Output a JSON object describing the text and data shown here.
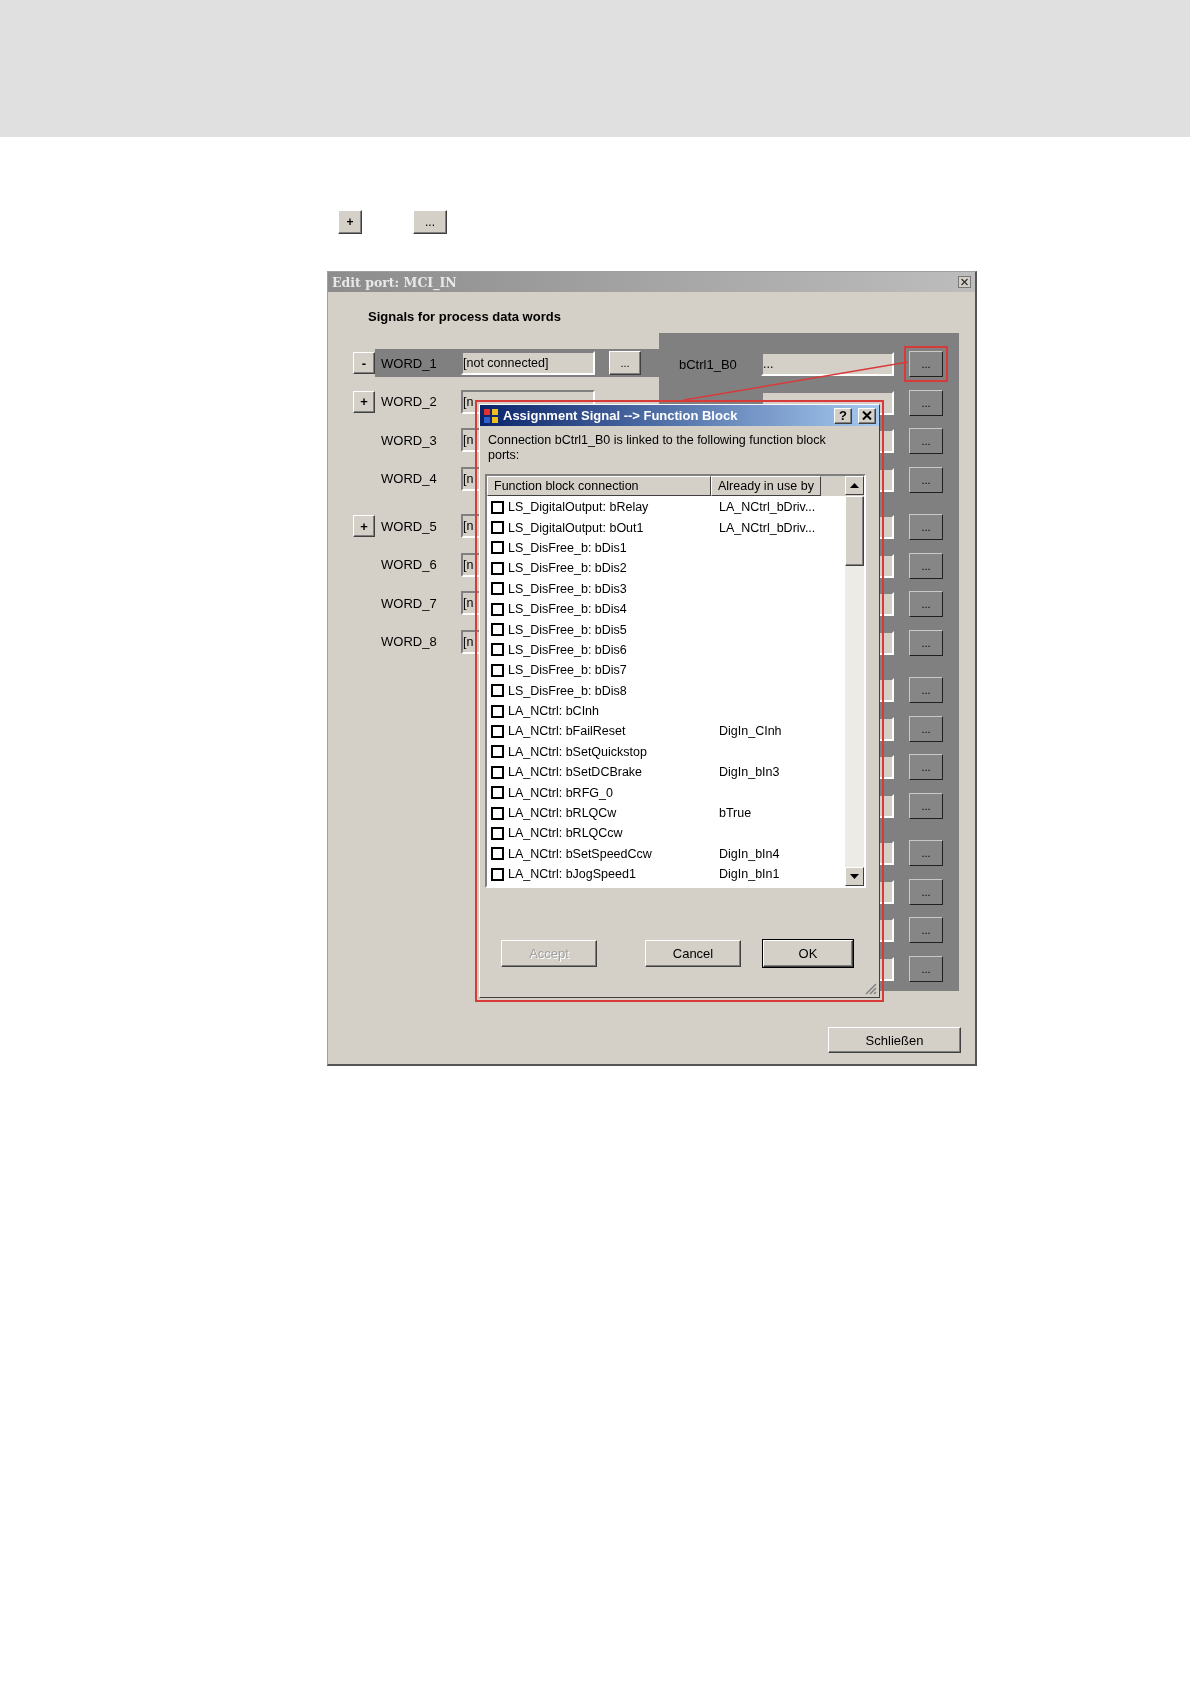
{
  "legend_buttons": [
    "+",
    "..."
  ],
  "window": {
    "title": "Edit port: MCI_IN",
    "heading": "Signals for process data words",
    "close_button": "Schließen"
  },
  "word_groups": [
    [
      {
        "toggle": "-",
        "label": "WORD_1",
        "value": "[not connected]",
        "button": "...",
        "selected": true
      },
      {
        "toggle": "+",
        "label": "WORD_2",
        "value": "[n",
        "selected": false
      },
      {
        "label": "WORD_3",
        "value": "[n",
        "selected": false
      },
      {
        "label": "WORD_4",
        "value": "[n",
        "selected": false
      }
    ],
    [
      {
        "toggle": "+",
        "label": "WORD_5",
        "value": "[n",
        "selected": false
      },
      {
        "label": "WORD_6",
        "value": "[n",
        "selected": false
      },
      {
        "label": "WORD_7",
        "value": "[n",
        "selected": false
      },
      {
        "label": "WORD_8",
        "value": "[n",
        "selected": false
      }
    ]
  ],
  "port_groups": [
    [
      {
        "label": "bCtrl1_B0",
        "value": "...",
        "button": "...",
        "highlighted": true
      },
      {
        "button": "...",
        "highlighted": false
      },
      {
        "button": "...",
        "highlighted": false
      },
      {
        "button": "...",
        "highlighted": false
      }
    ],
    [
      {
        "button": "...",
        "highlighted": false
      },
      {
        "button": "...",
        "highlighted": false
      },
      {
        "button": "...",
        "highlighted": false
      },
      {
        "button": "...",
        "highlighted": false
      }
    ],
    [
      {
        "button": "...",
        "highlighted": false
      },
      {
        "button": "...",
        "highlighted": false
      },
      {
        "button": "...",
        "highlighted": false
      },
      {
        "button": "...",
        "highlighted": false
      }
    ],
    [
      {
        "button": "...",
        "highlighted": false
      },
      {
        "button": "...",
        "highlighted": false
      },
      {
        "button": "...",
        "highlighted": false
      },
      {
        "button": "...",
        "highlighted": false
      }
    ]
  ],
  "assignment_dialog": {
    "title": "Assignment Signal --> Function Block",
    "help_button": "?",
    "message": "Connection bCtrl1_B0 is linked to the following function block ports:",
    "columns": [
      "Function block connection",
      "Already in use by"
    ],
    "rows": [
      {
        "checked": false,
        "name": "LS_DigitalOutput: bRelay",
        "used_by": "LA_NCtrl_bDriv..."
      },
      {
        "checked": false,
        "name": "LS_DigitalOutput: bOut1",
        "used_by": "LA_NCtrl_bDriv..."
      },
      {
        "checked": false,
        "name": "LS_DisFree_b: bDis1"
      },
      {
        "checked": false,
        "name": "LS_DisFree_b: bDis2"
      },
      {
        "checked": false,
        "name": "LS_DisFree_b: bDis3"
      },
      {
        "checked": false,
        "name": "LS_DisFree_b: bDis4"
      },
      {
        "checked": false,
        "name": "LS_DisFree_b: bDis5"
      },
      {
        "checked": false,
        "name": "LS_DisFree_b: bDis6"
      },
      {
        "checked": false,
        "name": "LS_DisFree_b: bDis7"
      },
      {
        "checked": false,
        "name": "LS_DisFree_b: bDis8"
      },
      {
        "checked": false,
        "name": "LA_NCtrl: bCInh"
      },
      {
        "checked": false,
        "name": "LA_NCtrl: bFailReset",
        "used_by": "DigIn_CInh"
      },
      {
        "checked": false,
        "name": "LA_NCtrl: bSetQuickstop"
      },
      {
        "checked": false,
        "name": "LA_NCtrl: bSetDCBrake",
        "used_by": "DigIn_bIn3"
      },
      {
        "checked": false,
        "name": "LA_NCtrl: bRFG_0"
      },
      {
        "checked": false,
        "name": "LA_NCtrl: bRLQCw",
        "used_by": "bTrue"
      },
      {
        "checked": false,
        "name": "LA_NCtrl: bRLQCcw"
      },
      {
        "checked": false,
        "name": "LA_NCtrl: bSetSpeedCcw",
        "used_by": "DigIn_bIn4"
      },
      {
        "checked": false,
        "name": "LA_NCtrl: bJogSpeed1",
        "used_by": "DigIn_bIn1"
      }
    ],
    "buttons": [
      {
        "label": "Accept",
        "disabled": true,
        "default": false
      },
      {
        "label": "Cancel",
        "disabled": false,
        "default": false
      },
      {
        "label": "OK",
        "disabled": false,
        "default": true
      }
    ]
  }
}
